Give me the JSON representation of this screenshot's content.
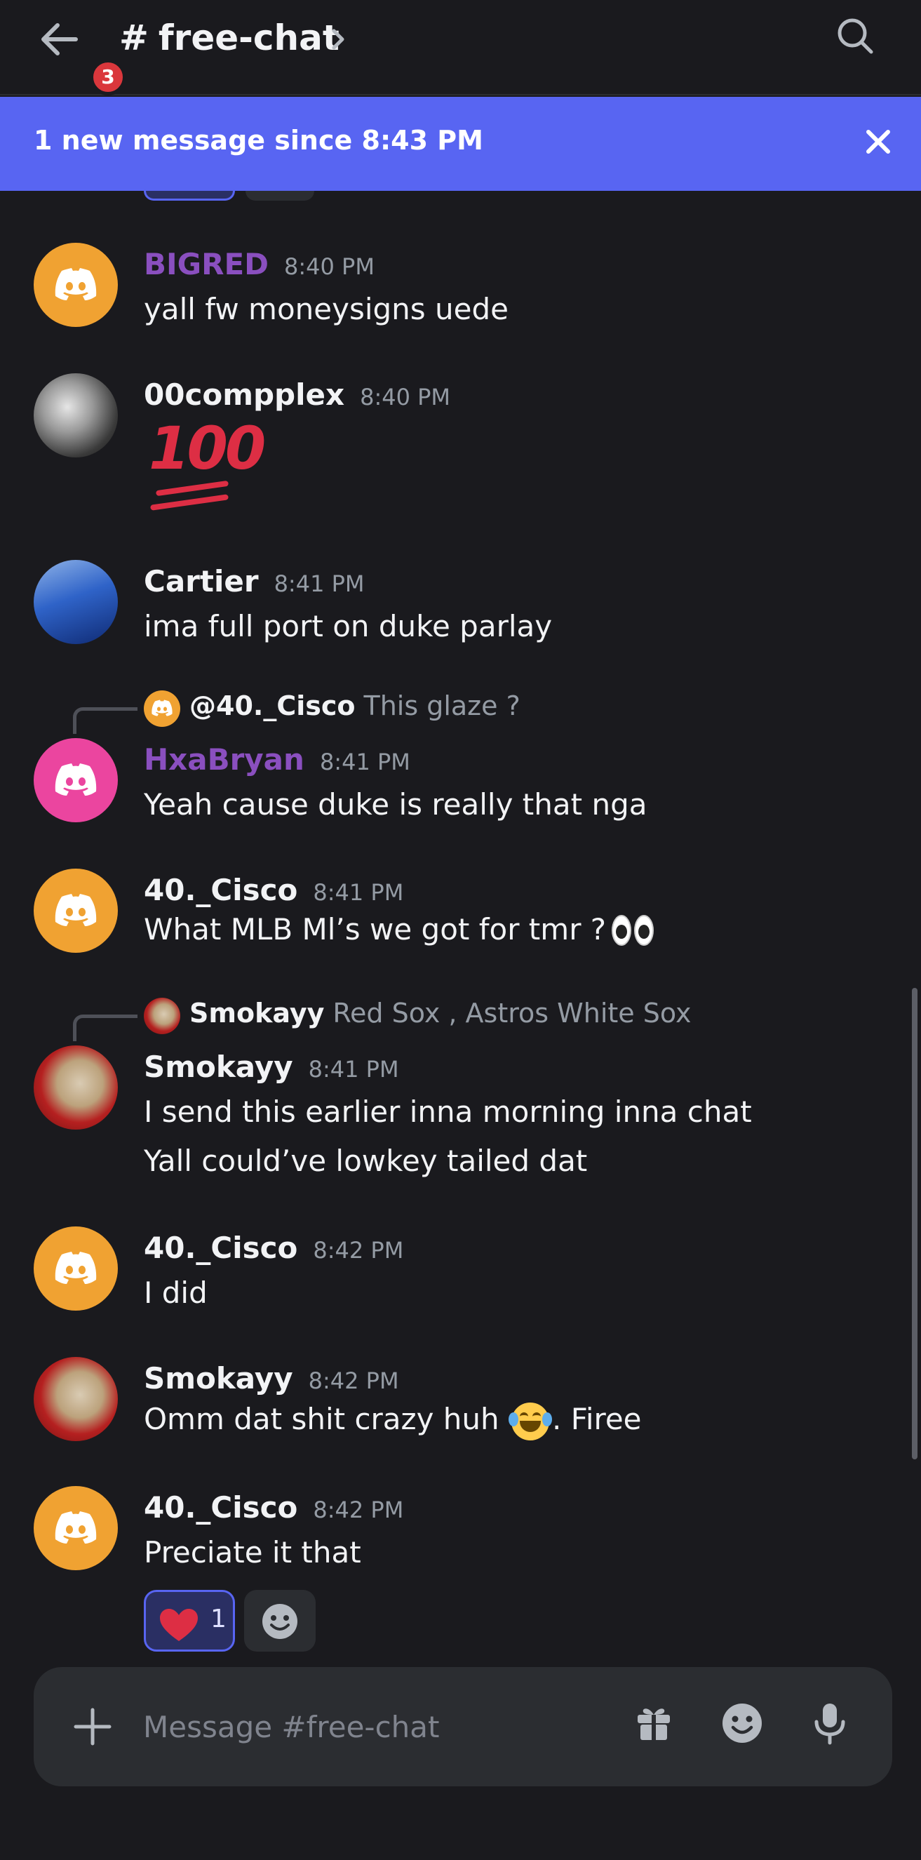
{
  "header": {
    "back_badge_count": "3",
    "hash": "#",
    "channel_name": "free-chat"
  },
  "banner": {
    "text": "1 new message since 8:43 PM"
  },
  "messages": [
    {
      "username": "BIGRED",
      "time": "8:40 PM",
      "text": "yall fw moneysigns uede"
    },
    {
      "username": "00compplex",
      "time": "8:40 PM",
      "text": "100"
    },
    {
      "username": "Cartier",
      "time": "8:41 PM",
      "text": "ima full port on duke parlay"
    },
    {
      "reply_name": "@40._Cisco",
      "reply_text": "This glaze ?",
      "username": "HxaBryan",
      "time": "8:41 PM",
      "text": "Yeah cause duke is really that nga"
    },
    {
      "username": "40._Cisco",
      "time": "8:41 PM",
      "text": "What MLB Ml’s we got for tmr ?"
    },
    {
      "reply_name": "Smokayy",
      "reply_text": "Red Sox , Astros  White Sox",
      "username": "Smokayy",
      "time": "8:41 PM",
      "text": "I send this earlier inna morning inna chat",
      "text2": "Yall could’ve lowkey tailed dat"
    },
    {
      "username": "40._Cisco",
      "time": "8:42 PM",
      "text": "I did"
    },
    {
      "username": "Smokayy",
      "time": "8:42 PM",
      "text_before": "Omm dat shit crazy huh",
      "text_after": ". Firee"
    },
    {
      "username": "40._Cisco",
      "time": "8:42 PM",
      "text": "Preciate it that",
      "reaction_count": "1"
    }
  ],
  "composer": {
    "placeholder": "Message #free-chat"
  },
  "colors": {
    "background": "#1a1a1e",
    "banner": "#5865f2",
    "accent_purple_name": "#8a4fbf",
    "avatar_orange": "#f0a232",
    "avatar_pink": "#eb459f"
  },
  "icons": {
    "back": "arrow-left-icon",
    "search": "search-icon",
    "close": "close-icon",
    "discord": "discord-logo-icon",
    "plus": "plus-icon",
    "gift": "gift-icon",
    "emoji": "emoji-icon",
    "mic": "mic-icon",
    "heart": "heart-icon"
  }
}
